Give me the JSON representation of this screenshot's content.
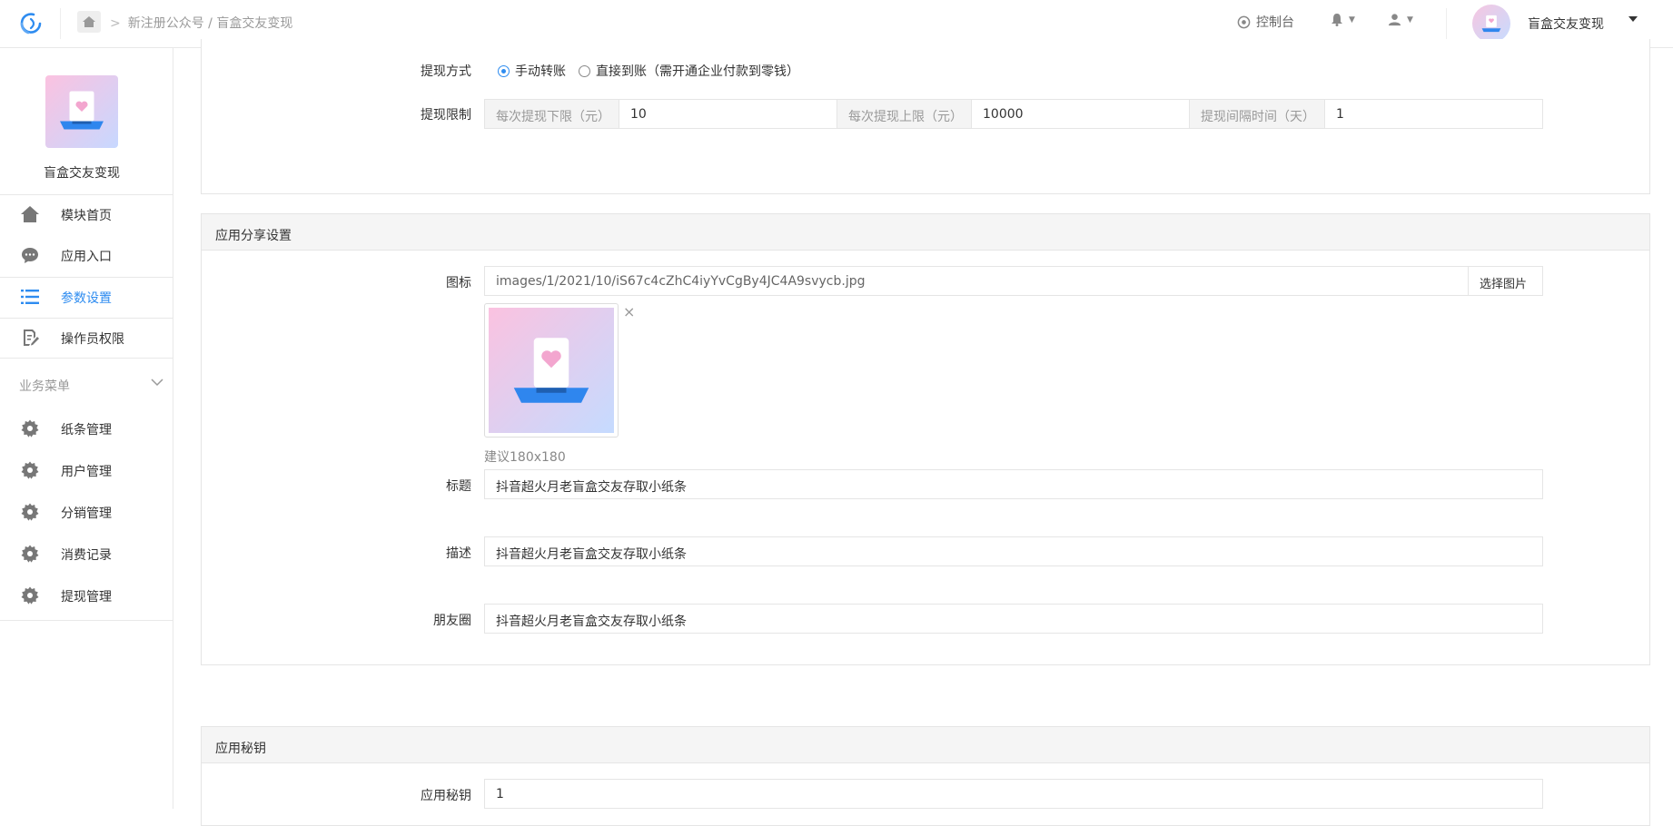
{
  "topbar": {
    "breadcrumb": "新注册公众号 / 盲盒交友变现",
    "console_label": "控制台",
    "account_name": "盲盒交友变现"
  },
  "sidebar": {
    "app_name": "盲盒交友变现",
    "items": [
      {
        "label": "模块首页",
        "icon": "home-icon"
      },
      {
        "label": "应用入口",
        "icon": "chat-icon"
      },
      {
        "label": "参数设置",
        "icon": "list-icon",
        "active": true
      },
      {
        "label": "操作员权限",
        "icon": "edit-doc-icon"
      }
    ],
    "section_label": "业务菜单",
    "business_items": [
      {
        "label": "纸条管理",
        "icon": "gear-icon"
      },
      {
        "label": "用户管理",
        "icon": "gear-icon"
      },
      {
        "label": "分销管理",
        "icon": "gear-icon"
      },
      {
        "label": "消费记录",
        "icon": "gear-icon"
      },
      {
        "label": "提现管理",
        "icon": "gear-icon"
      }
    ]
  },
  "withdraw": {
    "method_label": "提现方式",
    "method_options": [
      "手动转账",
      "直接到账（需开通企业付款到零钱）"
    ],
    "method_selected": "手动转账",
    "limit_label": "提现限制",
    "min_label": "每次提现下限（元）",
    "min_value": "10",
    "max_label": "每次提现上限（元）",
    "max_value": "10000",
    "interval_label": "提现间隔时间（天）",
    "interval_value": "1"
  },
  "share": {
    "panel_title": "应用分享设置",
    "icon_label": "图标",
    "icon_path": "images/1/2021/10/iS67c4cZhC4iyYvCgBy4JC4A9svycb.jpg",
    "select_image_button": "选择图片",
    "remove_symbol": "×",
    "size_hint": "建议180x180",
    "title_label": "标题",
    "title_value": "抖音超火月老盲盒交友存取小纸条",
    "desc_label": "描述",
    "desc_value": "抖音超火月老盲盒交友存取小纸条",
    "moments_label": "朋友圈",
    "moments_value": "抖音超火月老盲盒交友存取小纸条"
  },
  "secret": {
    "panel_title": "应用秘钥",
    "key_label": "应用秘钥",
    "key_value": "1"
  },
  "colors": {
    "accent": "#2e8cf0",
    "panel_header_bg": "#f5f5f5",
    "border": "#e5e5e5"
  }
}
